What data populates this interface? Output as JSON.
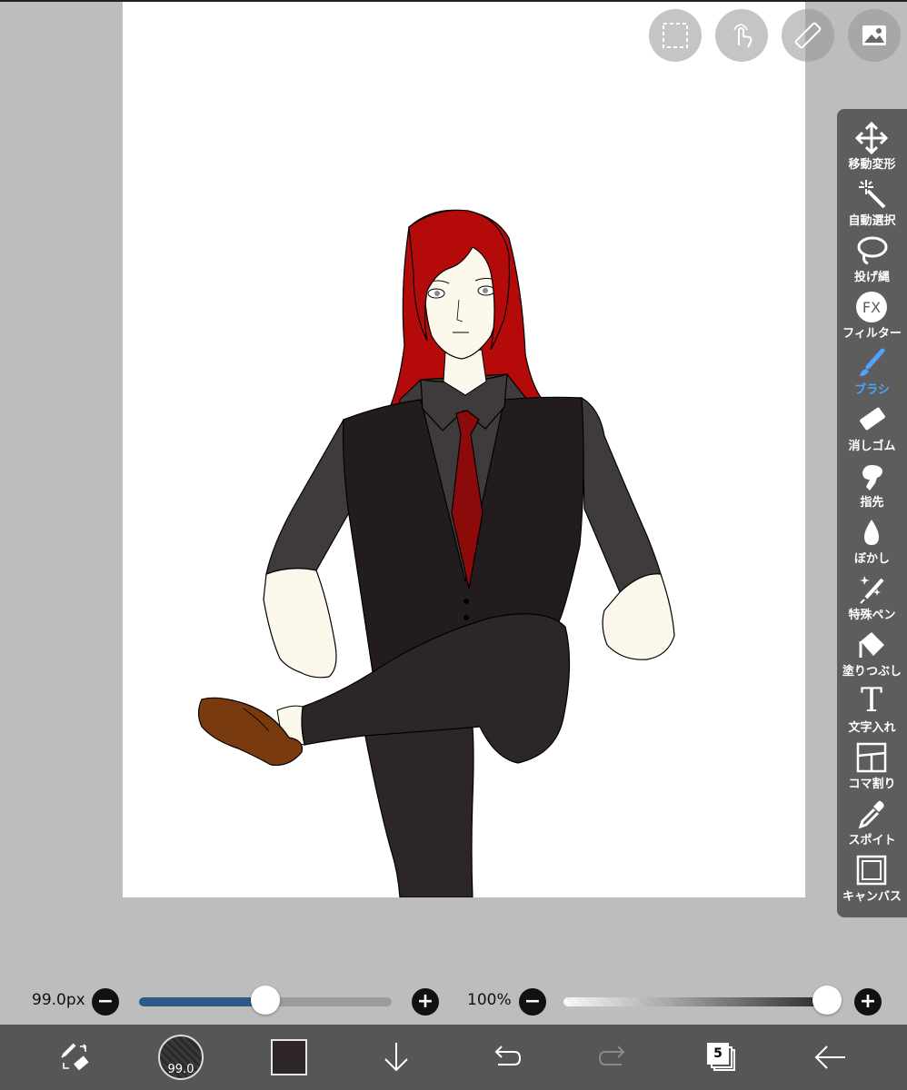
{
  "toolbar": {
    "items": [
      {
        "label": "移動変形",
        "icon": "move-icon"
      },
      {
        "label": "自動選択",
        "icon": "magic-wand-icon"
      },
      {
        "label": "投げ縄",
        "icon": "lasso-icon"
      },
      {
        "label": "フィルター",
        "icon": "fx-icon"
      },
      {
        "label": "ブラシ",
        "icon": "brush-icon",
        "active": true
      },
      {
        "label": "消しゴム",
        "icon": "eraser-icon"
      },
      {
        "label": "指先",
        "icon": "finger-icon"
      },
      {
        "label": "ぼかし",
        "icon": "blur-icon"
      },
      {
        "label": "特殊ペン",
        "icon": "special-pen-icon"
      },
      {
        "label": "塗りつぶし",
        "icon": "bucket-icon"
      },
      {
        "label": "文字入れ",
        "icon": "text-icon"
      },
      {
        "label": "コマ割り",
        "icon": "frame-divider-icon"
      },
      {
        "label": "スポイト",
        "icon": "eyedropper-icon"
      },
      {
        "label": "キャンバス",
        "icon": "canvas-icon"
      }
    ],
    "fx_text": "FX",
    "text_glyph": "T"
  },
  "brush": {
    "size_label": "99.0px",
    "size_fraction": 0.5,
    "opacity_label": "100%",
    "opacity_fraction": 1.0,
    "preview_label": "99.0"
  },
  "bottom": {
    "layer_count": "5",
    "color": "#2e2527"
  },
  "colors": {
    "accent": "#4fa3ff",
    "slider_fill": "#2d5a8a",
    "hair": "#b50a0a",
    "vest": "#231c1e",
    "shirt": "#3f3a3b",
    "tie": "#8c0a0a",
    "skin": "#fdf8ec",
    "shoe": "#7a3a10"
  }
}
